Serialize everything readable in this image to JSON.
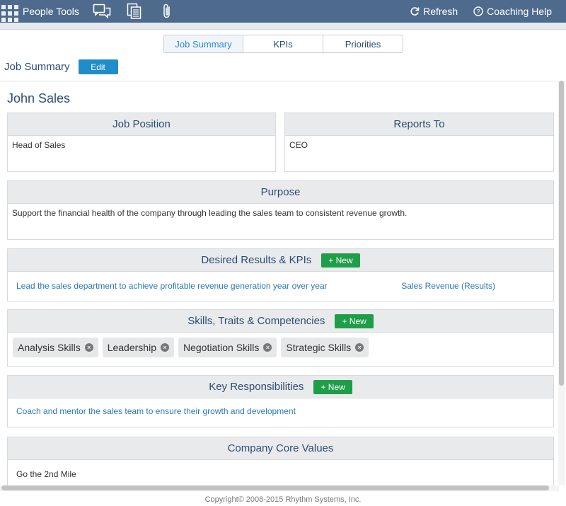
{
  "topbar": {
    "app_name": "People Tools",
    "icons": [
      "apps-grid-icon",
      "chat-icon",
      "documents-icon",
      "attachment-icon"
    ],
    "refresh_label": "Refresh",
    "coaching_label": "Coaching Help"
  },
  "tabs": [
    {
      "label": "Job Summary",
      "active": true
    },
    {
      "label": "KPIs",
      "active": false
    },
    {
      "label": "Priorities",
      "active": false
    }
  ],
  "section_title": "Job Summary",
  "edit_label": "Edit",
  "person_name": "John Sales",
  "job_position": {
    "header": "Job Position",
    "value": "Head of Sales"
  },
  "reports_to": {
    "header": "Reports To",
    "value": "CEO"
  },
  "purpose": {
    "header": "Purpose",
    "value": "Support the financial health of the company through leading the sales team to consistent revenue growth."
  },
  "desired_results": {
    "header": "Desired Results & KPIs",
    "new_label": "+ New",
    "items": [
      {
        "text": "Lead the sales department to achieve profitable revenue generation year over year",
        "kpi": "Sales Revenue (Results)"
      }
    ]
  },
  "skills": {
    "header": "Skills, Traits & Competencies",
    "new_label": "+ New",
    "chips": [
      "Analysis Skills",
      "Leadership",
      "Negotiation Skills",
      "Strategic Skills"
    ]
  },
  "responsibilities": {
    "header": "Key Responsibilities",
    "new_label": "+ New",
    "items": [
      "Coach and mentor the sales team to ensure their growth and development"
    ]
  },
  "core_values": {
    "header": "Company Core Values",
    "items": [
      "Go the 2nd Mile"
    ]
  },
  "footer": "Copyright© 2008-2015 Rhythm Systems, Inc.",
  "colors": {
    "topbar": "#4e6b8e",
    "edit": "#1f8dc9",
    "new": "#1e9e48",
    "link": "#2c79b6",
    "heading": "#2b4d74"
  }
}
